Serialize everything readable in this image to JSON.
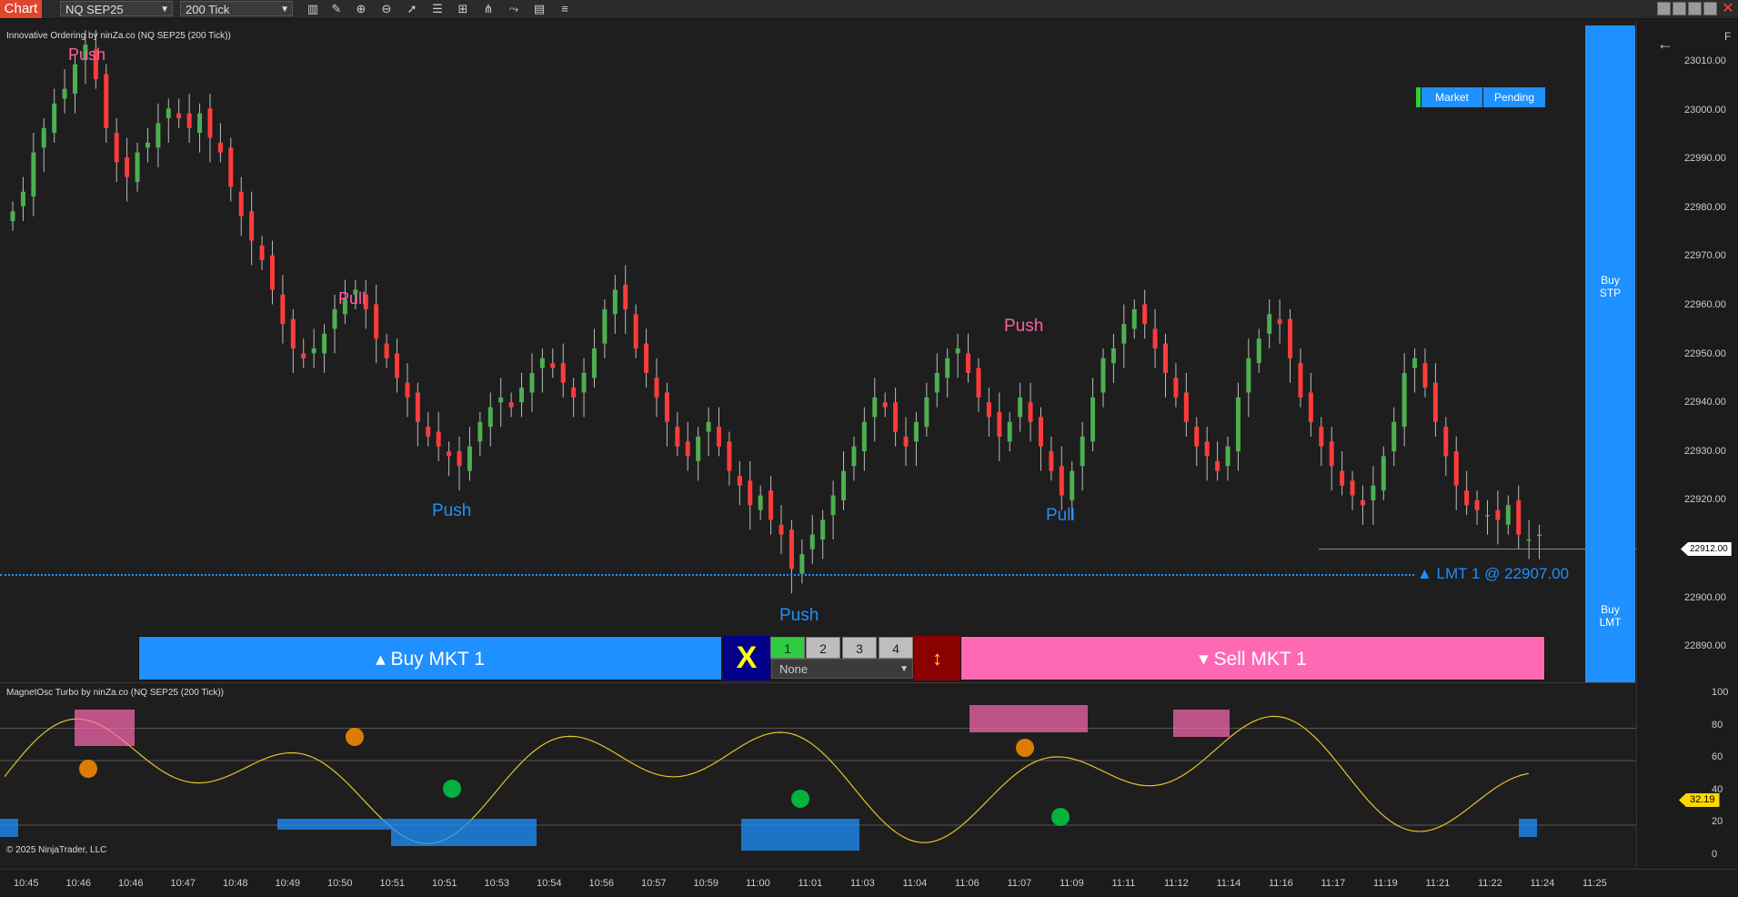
{
  "toolbar": {
    "tab_label": "Chart",
    "instrument": "NQ SEP25",
    "interval": "200 Tick",
    "icons": [
      "bar-type-icon",
      "draw-icon",
      "zoom-in-icon",
      "zoom-out-icon",
      "pointer-icon",
      "properties-icon",
      "template-icon",
      "indicators-icon",
      "strategies-icon",
      "data-box-icon"
    ]
  },
  "main_chart": {
    "indicator_title": "Innovative Ordering by ninZa.co (NQ SEP25 (200 Tick))",
    "price_labels": [
      "23010.00",
      "23000.00",
      "22990.00",
      "22980.00",
      "22970.00",
      "22960.00",
      "22950.00",
      "22940.00",
      "22930.00",
      "22920.00",
      "22910.00",
      "22900.00",
      "22890.00"
    ],
    "current_price": "22912.00",
    "signals": [
      {
        "text": "Push",
        "color": "#ff5fa2"
      },
      {
        "text": "Pull",
        "color": "#ff5fa2"
      },
      {
        "text": "Push",
        "color": "#1e90ff"
      },
      {
        "text": "Push",
        "color": "#1e90ff"
      },
      {
        "text": "Push",
        "color": "#ff5fa2"
      },
      {
        "text": "Pull",
        "color": "#1e90ff"
      }
    ],
    "limit_order_label": "▲ LMT 1 @ 22907.00",
    "arrow_icon": "←",
    "corner_label": "F"
  },
  "order_panel": {
    "market_label": "Market",
    "pending_label": "Pending",
    "buy_stp_line1": "Buy",
    "buy_stp_line2": "STP",
    "buy_lmt_line1": "Buy",
    "buy_lmt_line2": "LMT",
    "buy_mkt_label": "▴ Buy MKT 1",
    "sell_mkt_label": "▾ Sell MKT 1",
    "close_label": "X",
    "reverse_label": "↕",
    "quantities": [
      "1",
      "2",
      "3",
      "4"
    ],
    "qty_select_value": "None"
  },
  "oscillator": {
    "title": "MagnetOsc Turbo by ninZa.co (NQ SEP25 (200 Tick))",
    "levels": [
      "100",
      "80",
      "60",
      "40",
      "20",
      "0"
    ],
    "current_value": "32.19",
    "copyright": "© 2025 NinjaTrader, LLC"
  },
  "time_axis": [
    "10:45",
    "10:46",
    "10:46",
    "10:47",
    "10:48",
    "10:49",
    "10:50",
    "10:51",
    "10:51",
    "10:53",
    "10:54",
    "10:56",
    "10:57",
    "10:59",
    "11:00",
    "11:01",
    "11:03",
    "11:04",
    "11:06",
    "11:07",
    "11:09",
    "11:11",
    "11:12",
    "11:14",
    "11:16",
    "11:17",
    "11:19",
    "11:21",
    "11:22",
    "11:24",
    "11:25"
  ],
  "colors": {
    "up_candle": "#4caf50",
    "down_candle": "#ff3b3b",
    "buy_blue": "#1e90ff",
    "sell_pink": "#ff69b4",
    "osc_line": "#e6c229",
    "accent_red": "#e0462c"
  },
  "chart_data": {
    "type": "candlestick",
    "series_close": [
      22978,
      22982,
      22990,
      22995,
      23000,
      23003,
      23008,
      23012,
      23005,
      22995,
      22988,
      22985,
      22990,
      22992,
      22996,
      22999,
      22997,
      22995,
      22998,
      22993,
      22990,
      22983,
      22977,
      22972,
      22968,
      22962,
      22955,
      22950,
      22948,
      22950,
      22953,
      22958,
      22960,
      22962,
      22958,
      22952,
      22948,
      22944,
      22940,
      22935,
      22932,
      22930,
      22928,
      22926,
      22930,
      22935,
      22938,
      22940,
      22938,
      22942,
      22945,
      22948,
      22946,
      22943,
      22940,
      22945,
      22950,
      22958,
      22962,
      22958,
      22950,
      22945,
      22940,
      22935,
      22930,
      22928,
      22932,
      22935,
      22930,
      22925,
      22922,
      22918,
      22920,
      22915,
      22912,
      22905,
      22908,
      22912,
      22915,
      22920,
      22925,
      22930,
      22935,
      22940,
      22938,
      22933,
      22930,
      22935,
      22940,
      22945,
      22948,
      22950,
      22945,
      22940,
      22936,
      22932,
      22935,
      22940,
      22935,
      22930,
      22925,
      22920,
      22925,
      22932,
      22940,
      22948,
      22950,
      22955,
      22958,
      22955,
      22950,
      22945,
      22940,
      22935,
      22930,
      22928,
      22925,
      22930,
      22940,
      22948,
      22952,
      22957,
      22955,
      22948,
      22940,
      22935,
      22930,
      22926,
      22922,
      22920,
      22918,
      22922,
      22928,
      22935,
      22945,
      22948,
      22942,
      22935,
      22928,
      22922,
      22918,
      22917,
      22916,
      22915,
      22918,
      22912,
      22911,
      22912
    ]
  }
}
